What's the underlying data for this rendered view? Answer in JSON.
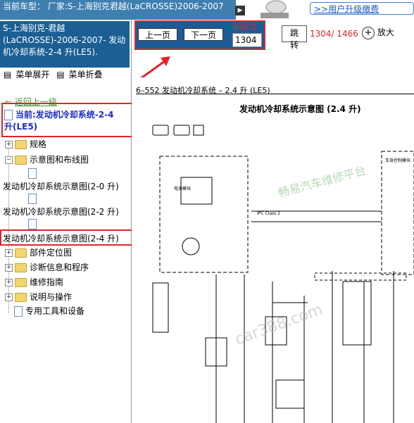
{
  "topbar": {
    "text": "当前车型： 厂家:S-上海别克君越(LaCROSSE)2006-2007"
  },
  "car_box": {
    "text": "S-上海别克-君越(LaCROSSE)-2006-2007- 发动机冷却系统-2-4 升(LE5)."
  },
  "menu": {
    "expand": "菜单展开",
    "collapse": "菜单折叠"
  },
  "back": {
    "label": "返回上一级"
  },
  "current": {
    "label": "当前:发动机冷却系统-2-4 升(LE5)"
  },
  "tree": {
    "spec": "规格",
    "diagrams": "示意图和布线图",
    "item_20": "发动机冷却系统示意图(2-0 升)",
    "item_22": "发动机冷却系统示意图(2-2 升)",
    "item_24": "发动机冷却系统示意图(2-4 升)",
    "component_loc": "部件定位图",
    "diag_info": "诊断信息和程序",
    "repair": "维修指南",
    "description": "说明与操作",
    "tools": "专用工具和设备"
  },
  "toolbar": {
    "prev": "上一页",
    "next": "下一页",
    "current_label": "当前为",
    "current_page": "1304",
    "jump": "跳转",
    "page_count": "1304/ 1466",
    "zoom": "放大"
  },
  "upgrade": {
    "link": ">>用户升级缴费"
  },
  "document": {
    "page_header": "6–552       发动机冷却系统 – 2.4 升 (LE5)",
    "diagram_title": "发动机冷却系统示意图 (2.4 升)",
    "watermark": "畅易汽车维修平台"
  },
  "colors": {
    "accent_red": "#e0242a",
    "panel_blue": "#1b5f94",
    "topbar_blue": "#3e7fb0"
  }
}
